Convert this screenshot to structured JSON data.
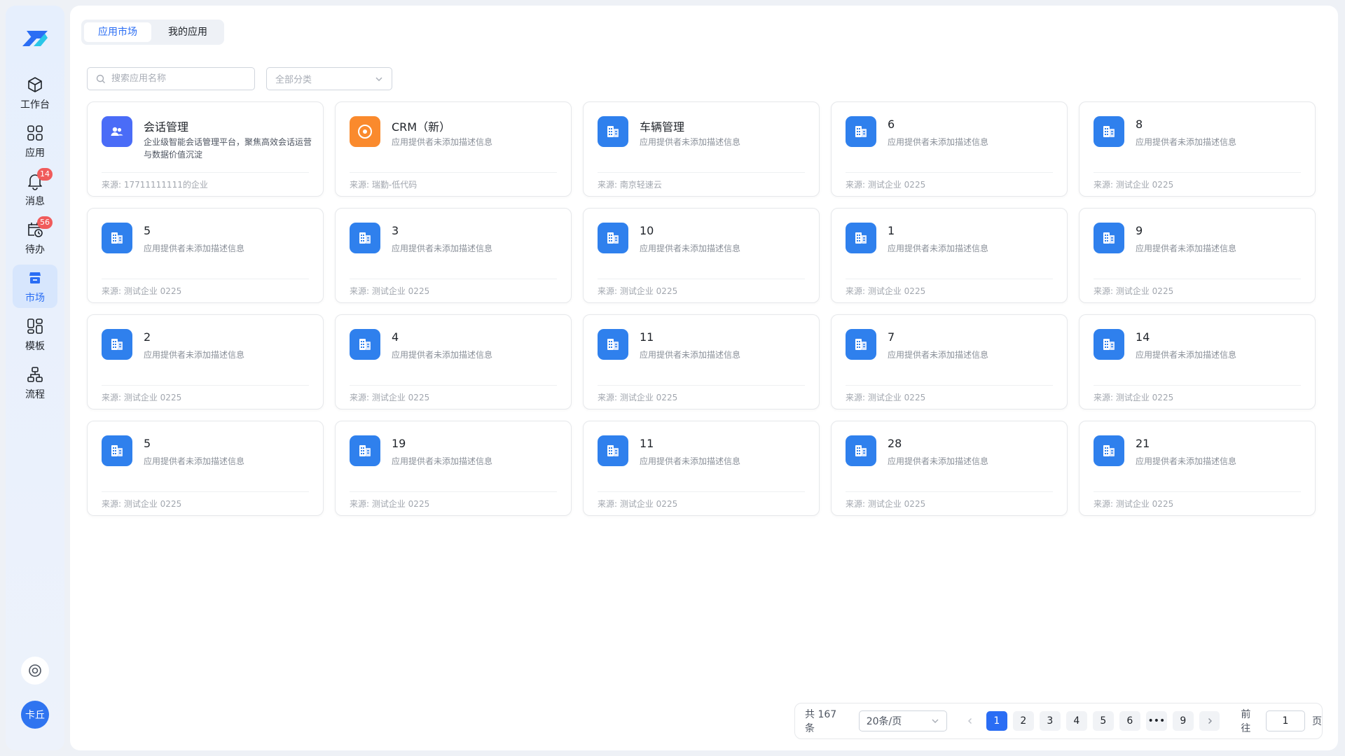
{
  "sidebar": {
    "items": [
      {
        "label": "工作台",
        "icon": "cube-icon"
      },
      {
        "label": "应用",
        "icon": "apps-grid-icon"
      },
      {
        "label": "消息",
        "icon": "bell-icon",
        "badge": "14"
      },
      {
        "label": "待办",
        "icon": "calendar-clock-icon",
        "badge": "56"
      },
      {
        "label": "市场",
        "icon": "store-icon",
        "active": true
      },
      {
        "label": "模板",
        "icon": "template-icon"
      },
      {
        "label": "流程",
        "icon": "flow-icon"
      }
    ],
    "avatar_text": "卡丘"
  },
  "tabs": [
    {
      "label": "应用市场",
      "active": true
    },
    {
      "label": "我的应用",
      "active": false
    }
  ],
  "search": {
    "placeholder": "搜索应用名称"
  },
  "category_select": {
    "value": "全部分类"
  },
  "cards": [
    {
      "title": "会话管理",
      "desc": "企业级智能会话管理平台，聚焦高效会话运营与数据价值沉淀",
      "source": "来源: 17711111111的企业",
      "icon": "people-icon",
      "color": "#4a6cf7"
    },
    {
      "title": "CRM（新）",
      "desc": "应用提供者未添加描述信息",
      "source": "来源: 瑞勤-低代码",
      "icon": "crm-icon",
      "color": "#fa8a2d"
    },
    {
      "title": "车辆管理",
      "desc": "应用提供者未添加描述信息",
      "source": "来源: 南京轻速云",
      "icon": "building-icon",
      "color": "#2f80ed"
    },
    {
      "title": "6",
      "desc": "应用提供者未添加描述信息",
      "source": "来源: 测试企业 0225",
      "icon": "building-icon",
      "color": "#2f80ed"
    },
    {
      "title": "8",
      "desc": "应用提供者未添加描述信息",
      "source": "来源: 测试企业 0225",
      "icon": "building-icon",
      "color": "#2f80ed"
    },
    {
      "title": "5",
      "desc": "应用提供者未添加描述信息",
      "source": "来源: 测试企业 0225",
      "icon": "building-icon",
      "color": "#2f80ed"
    },
    {
      "title": "3",
      "desc": "应用提供者未添加描述信息",
      "source": "来源: 测试企业 0225",
      "icon": "building-icon",
      "color": "#2f80ed"
    },
    {
      "title": "10",
      "desc": "应用提供者未添加描述信息",
      "source": "来源: 测试企业 0225",
      "icon": "building-icon",
      "color": "#2f80ed"
    },
    {
      "title": "1",
      "desc": "应用提供者未添加描述信息",
      "source": "来源: 测试企业 0225",
      "icon": "building-icon",
      "color": "#2f80ed"
    },
    {
      "title": "9",
      "desc": "应用提供者未添加描述信息",
      "source": "来源: 测试企业 0225",
      "icon": "building-icon",
      "color": "#2f80ed"
    },
    {
      "title": "2",
      "desc": "应用提供者未添加描述信息",
      "source": "来源: 测试企业 0225",
      "icon": "building-icon",
      "color": "#2f80ed"
    },
    {
      "title": "4",
      "desc": "应用提供者未添加描述信息",
      "source": "来源: 测试企业 0225",
      "icon": "building-icon",
      "color": "#2f80ed"
    },
    {
      "title": "11",
      "desc": "应用提供者未添加描述信息",
      "source": "来源: 测试企业 0225",
      "icon": "building-icon",
      "color": "#2f80ed"
    },
    {
      "title": "7",
      "desc": "应用提供者未添加描述信息",
      "source": "来源: 测试企业 0225",
      "icon": "building-icon",
      "color": "#2f80ed"
    },
    {
      "title": "14",
      "desc": "应用提供者未添加描述信息",
      "source": "来源: 测试企业 0225",
      "icon": "building-icon",
      "color": "#2f80ed"
    },
    {
      "title": "5",
      "desc": "应用提供者未添加描述信息",
      "source": "来源: 测试企业 0225",
      "icon": "building-icon",
      "color": "#2f80ed"
    },
    {
      "title": "19",
      "desc": "应用提供者未添加描述信息",
      "source": "来源: 测试企业 0225",
      "icon": "building-icon",
      "color": "#2f80ed"
    },
    {
      "title": "11",
      "desc": "应用提供者未添加描述信息",
      "source": "来源: 测试企业 0225",
      "icon": "building-icon",
      "color": "#2f80ed"
    },
    {
      "title": "28",
      "desc": "应用提供者未添加描述信息",
      "source": "来源: 测试企业 0225",
      "icon": "building-icon",
      "color": "#2f80ed"
    },
    {
      "title": "21",
      "desc": "应用提供者未添加描述信息",
      "source": "来源: 测试企业 0225",
      "icon": "building-icon",
      "color": "#2f80ed"
    }
  ],
  "pagination": {
    "total_text": "共 167 条",
    "page_size": "20条/页",
    "pages": [
      "1",
      "2",
      "3",
      "4",
      "5",
      "6",
      "•••",
      "9"
    ],
    "current": "1",
    "goto_label": "前往",
    "goto_value": "1",
    "goto_suffix": "页"
  },
  "colors": {
    "accent": "#2a6df4",
    "badge": "#f05b5b"
  }
}
